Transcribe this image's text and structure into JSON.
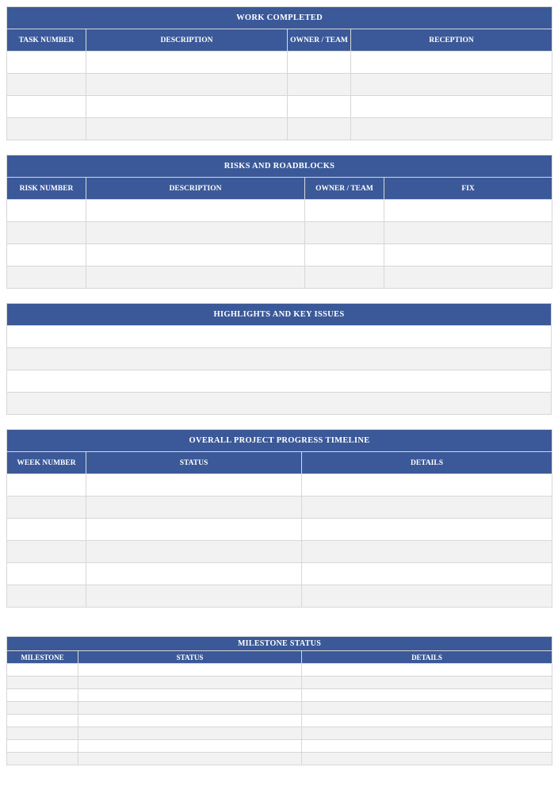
{
  "work_completed": {
    "title": "WORK COMPLETED",
    "headers": {
      "task": "TASK NUMBER",
      "desc": "DESCRIPTION",
      "owner": "OWNER / TEAM",
      "recep": "RECEPTION"
    },
    "rows": [
      {
        "task": "",
        "desc": "",
        "owner": "",
        "recep": ""
      },
      {
        "task": "",
        "desc": "",
        "owner": "",
        "recep": ""
      },
      {
        "task": "",
        "desc": "",
        "owner": "",
        "recep": ""
      },
      {
        "task": "",
        "desc": "",
        "owner": "",
        "recep": ""
      }
    ]
  },
  "risks": {
    "title": "RISKS AND ROADBLOCKS",
    "headers": {
      "num": "RISK NUMBER",
      "desc": "DESCRIPTION",
      "owner": "OWNER / TEAM",
      "fix": "FIX"
    },
    "rows": [
      {
        "num": "",
        "desc": "",
        "owner": "",
        "fix": ""
      },
      {
        "num": "",
        "desc": "",
        "owner": "",
        "fix": ""
      },
      {
        "num": "",
        "desc": "",
        "owner": "",
        "fix": ""
      },
      {
        "num": "",
        "desc": "",
        "owner": "",
        "fix": ""
      }
    ]
  },
  "highlights": {
    "title": "HIGHLIGHTS AND KEY ISSUES",
    "rows": [
      "",
      "",
      "",
      ""
    ]
  },
  "timeline": {
    "title": "OVERALL PROJECT PROGRESS TIMELINE",
    "headers": {
      "week": "WEEK NUMBER",
      "status": "STATUS",
      "details": "DETAILS"
    },
    "rows": [
      {
        "week": "",
        "status": "",
        "details": ""
      },
      {
        "week": "",
        "status": "",
        "details": ""
      },
      {
        "week": "",
        "status": "",
        "details": ""
      },
      {
        "week": "",
        "status": "",
        "details": ""
      },
      {
        "week": "",
        "status": "",
        "details": ""
      },
      {
        "week": "",
        "status": "",
        "details": ""
      }
    ]
  },
  "milestone": {
    "title": "MILESTONE STATUS",
    "headers": {
      "milestone": "MILESTONE",
      "status": "STATUS",
      "details": "DETAILS"
    },
    "rows": [
      {
        "milestone": "",
        "status": "",
        "details": ""
      },
      {
        "milestone": "",
        "status": "",
        "details": ""
      },
      {
        "milestone": "",
        "status": "",
        "details": ""
      },
      {
        "milestone": "",
        "status": "",
        "details": ""
      },
      {
        "milestone": "",
        "status": "",
        "details": ""
      },
      {
        "milestone": "",
        "status": "",
        "details": ""
      },
      {
        "milestone": "",
        "status": "",
        "details": ""
      },
      {
        "milestone": "",
        "status": "",
        "details": ""
      }
    ]
  }
}
